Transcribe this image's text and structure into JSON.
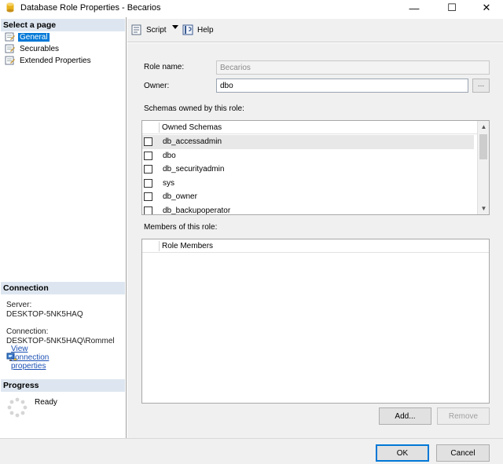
{
  "window": {
    "title": "Database Role Properties - Becarios",
    "min_glyph": "—",
    "max_glyph": "☐",
    "close_glyph": "✕"
  },
  "left": {
    "select_page_header": "Select a page",
    "pages": [
      {
        "label": "General",
        "icon": "page-wrench-icon",
        "selected": true
      },
      {
        "label": "Securables",
        "icon": "page-wrench-icon",
        "selected": false
      },
      {
        "label": "Extended Properties",
        "icon": "page-wrench-icon",
        "selected": false
      }
    ],
    "connection_header": "Connection",
    "server_label": "Server:",
    "server_value": "DESKTOP-5NK5HAQ",
    "connection_label": "Connection:",
    "connection_value": "DESKTOP-5NK5HAQ\\Rommel",
    "view_link": "View connection properties",
    "progress_header": "Progress",
    "progress_status": "Ready"
  },
  "toolbar": {
    "script_label": "Script",
    "help_label": "Help"
  },
  "general": {
    "role_name_label": "Role name:",
    "role_name_value": "Becarios",
    "owner_label": "Owner:",
    "owner_value": "dbo",
    "browse_label": "...",
    "schemas_label": "Schemas owned by this role:",
    "schemas_header": "Owned Schemas",
    "schemas": [
      {
        "name": "db_accessadmin",
        "checked": false
      },
      {
        "name": "dbo",
        "checked": false
      },
      {
        "name": "db_securityadmin",
        "checked": false
      },
      {
        "name": "sys",
        "checked": false
      },
      {
        "name": "db_owner",
        "checked": false
      },
      {
        "name": "db_backupoperator",
        "checked": false
      }
    ],
    "members_label": "Members of this role:",
    "members_header": "Role Members",
    "add_label": "Add...",
    "remove_label": "Remove"
  },
  "footer": {
    "ok_label": "OK",
    "cancel_label": "Cancel"
  },
  "colors": {
    "selection": "#0078d7",
    "section_header_bg": "#dde6f0",
    "link": "#1a4fb4"
  }
}
